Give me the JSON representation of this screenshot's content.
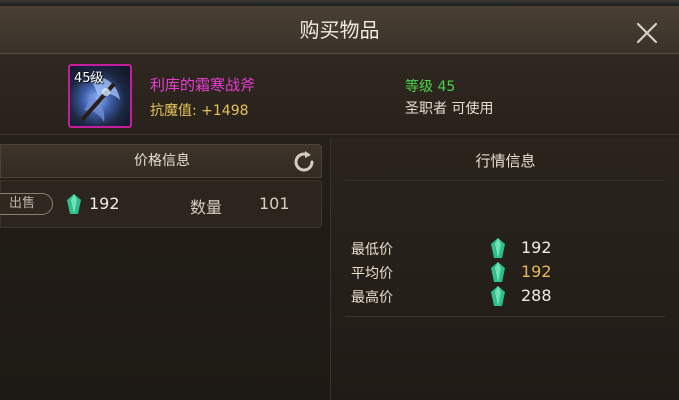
{
  "dialog": {
    "title": "购买物品"
  },
  "item": {
    "level_badge": "45级",
    "name": "利库的霜寒战斧",
    "stat": "抗魔值: +1498",
    "required_level": "等级 45",
    "usable_by": "圣职者 可使用",
    "name_color": "#e83cd3",
    "border_color": "#c31e9e"
  },
  "price_panel": {
    "header": "价格信息",
    "sell_button": "出售",
    "price": "192",
    "quantity_label": "数量",
    "quantity": "101",
    "currency_icon": "green-gem-icon"
  },
  "market_panel": {
    "header": "行情信息",
    "rows": [
      {
        "label": "最低价",
        "value": "192"
      },
      {
        "label": "平均价",
        "value": "192"
      },
      {
        "label": "最高价",
        "value": "288"
      }
    ]
  }
}
